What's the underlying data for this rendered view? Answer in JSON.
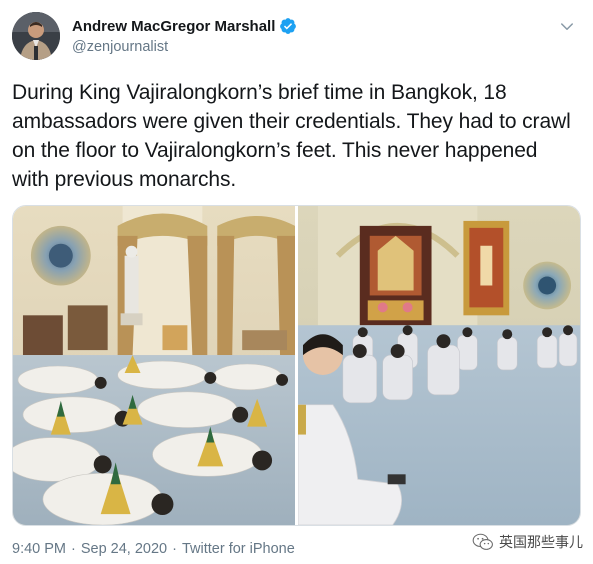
{
  "tweet": {
    "author": {
      "display_name": "Andrew MacGregor Marshall",
      "handle": "@zenjournalist",
      "verified": true,
      "avatar_icon": "user-avatar"
    },
    "text": "During King Vajiralongkorn’s brief time in Bangkok, 18 ambassadors were given their credentials. They had to crawl on the floor to Vajiralongkorn’s feet. This never happened with previous monarchs.",
    "media": [
      {
        "name": "photo-ambassadors-prostrating"
      },
      {
        "name": "photo-ambassadors-kneeling-hall"
      }
    ],
    "meta": {
      "time": "9:40 PM",
      "separator": "·",
      "date": "Sep 24, 2020",
      "source": "Twitter for iPhone"
    }
  },
  "watermark": {
    "text": "英国那些事儿",
    "icon": "wechat-logo-icon"
  },
  "colors": {
    "text_primary": "#14171a",
    "text_secondary": "#657786",
    "verified_blue": "#1da1f2",
    "border": "#d9dfe4"
  }
}
